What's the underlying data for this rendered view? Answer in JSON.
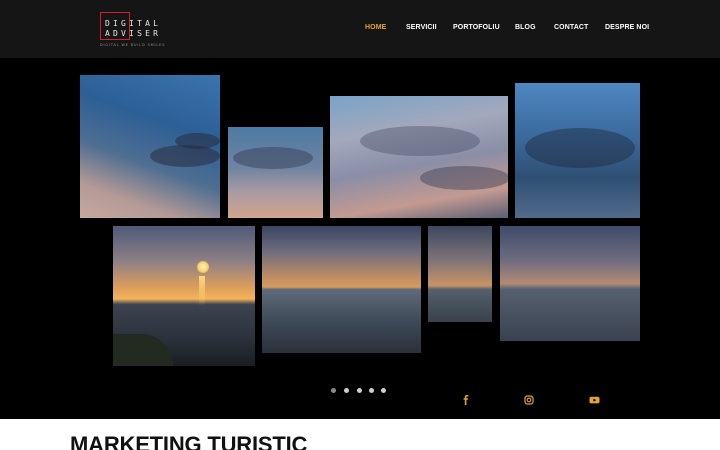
{
  "brand": {
    "logo_line1": "DIGITAL",
    "logo_line2": "ADVISER",
    "tagline": "DIGITAL WE BUILD SMILES",
    "accent_color": "#d21f2c"
  },
  "nav": {
    "items": [
      {
        "label": "HOME",
        "active": true
      },
      {
        "label": "SERVICII",
        "active": false
      },
      {
        "label": "PORTOFOLIU",
        "active": false
      },
      {
        "label": "BLOG",
        "active": false
      },
      {
        "label": "CONTACT",
        "active": false
      },
      {
        "label": "DESPRE NOI",
        "active": false
      }
    ],
    "active_color": "#e4a336"
  },
  "hero": {
    "slider_dots": 5,
    "active_dot": 0,
    "social_icons": [
      "facebook-icon",
      "instagram-icon",
      "youtube-icon"
    ],
    "social_color": "#e4a336"
  },
  "section": {
    "title": "MARKETING TURISTIC"
  }
}
